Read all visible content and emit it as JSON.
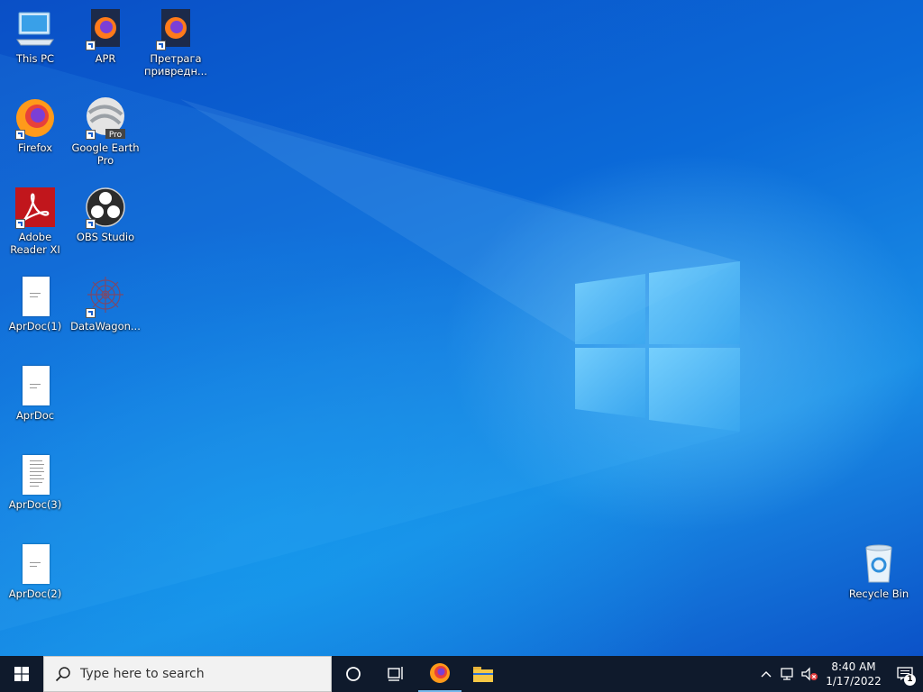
{
  "desktop": {
    "icons": [
      {
        "label": "This PC"
      },
      {
        "label": "APR"
      },
      {
        "label": "Претрага привредн..."
      },
      {
        "label": "Firefox"
      },
      {
        "label": "Google Earth Pro",
        "badge": "Pro"
      },
      {
        "label": "Adobe Reader XI"
      },
      {
        "label": "OBS Studio"
      },
      {
        "label": "AprDoc(1)"
      },
      {
        "label": "DataWagon..."
      },
      {
        "label": "AprDoc"
      },
      {
        "label": "AprDoc(3)"
      },
      {
        "label": "AprDoc(2)"
      },
      {
        "label": "Recycle Bin"
      }
    ]
  },
  "taskbar": {
    "search_placeholder": "Type here to search",
    "apps": [
      "Firefox",
      "File Explorer"
    ],
    "clock": {
      "time": "8:40 AM",
      "date": "1/17/2022"
    },
    "notification_count": "1"
  },
  "colors": {
    "taskbar": "#0f1a2c",
    "desktop_accent": "#0b6ad8",
    "active_indicator": "#76b9ed"
  }
}
